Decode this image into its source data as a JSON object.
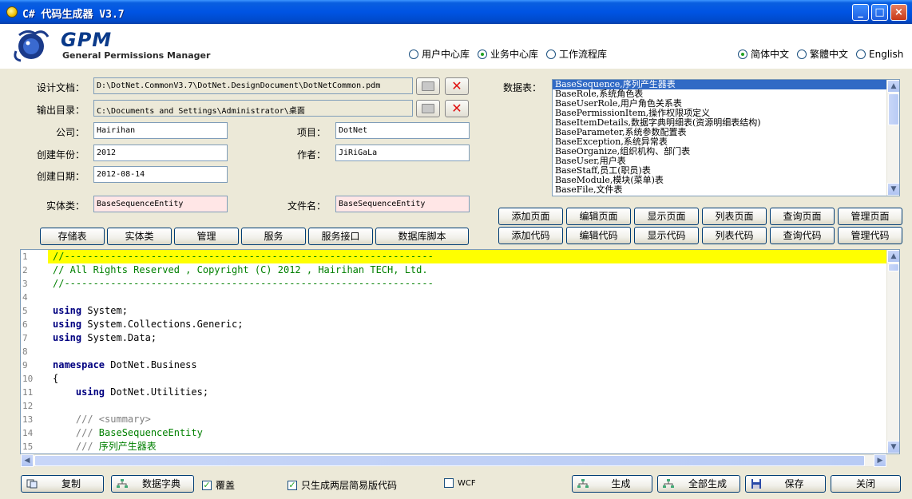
{
  "window": {
    "title": "C# 代码生成器 V3.7"
  },
  "titlebar": {
    "minimize": "_",
    "maximize": "□",
    "close": "×"
  },
  "header": {
    "logo_text": "GPM",
    "logo_sub": "General Permissions Manager",
    "db_options": [
      "用户中心库",
      "业务中心库",
      "工作流程库"
    ],
    "db_selected": 1,
    "lang_options": [
      "简体中文",
      "繁體中文",
      "English"
    ],
    "lang_selected": 0
  },
  "form": {
    "design_doc_label": "设计文档：",
    "design_doc_value": "D:\\DotNet.CommonV3.7\\DotNet.DesignDocument\\DotNetCommon.pdm",
    "output_dir_label": "输出目录：",
    "output_dir_value": "C:\\Documents and Settings\\Administrator\\桌面",
    "company_label": "公司：",
    "company_value": "Hairihan",
    "project_label": "项目：",
    "project_value": "DotNet",
    "year_label": "创建年份：",
    "year_value": "2012",
    "author_label": "作者：",
    "author_value": "JiRiGaLa",
    "date_label": "创建日期：",
    "date_value": "2012-08-14",
    "entity_label": "实体类：",
    "entity_value": "BaseSequenceEntity",
    "filename_label": "文件名：",
    "filename_value": "BaseSequenceEntity"
  },
  "left_buttons": [
    "存储表",
    "实体类",
    "管理",
    "服务",
    "服务接口",
    "数据库脚本"
  ],
  "tables": {
    "label": "数据表：",
    "items": [
      "BaseSequence,序列产生器表",
      "BaseRole,系统角色表",
      "BaseUserRole,用户角色关系表",
      "BasePermissionItem,操作权限项定义",
      "BaseItemDetails,数据字典明细表(资源明细表结构)",
      "BaseParameter,系统参数配置表",
      "BaseException,系统异常表",
      "BaseOrganize,组织机构、部门表",
      "BaseUser,用户表",
      "BaseStaff,员工(职员)表",
      "BaseModule,模块(菜单)表",
      "BaseFile,文件表"
    ],
    "selected": 0
  },
  "page_buttons": [
    "添加页面",
    "编辑页面",
    "显示页面",
    "列表页面",
    "查询页面",
    "管理页面"
  ],
  "code_buttons": [
    "添加代码",
    "编辑代码",
    "显示代码",
    "列表代码",
    "查询代码",
    "管理代码"
  ],
  "editor": {
    "line_numbers": [
      "1",
      "2",
      "3",
      "4",
      "5",
      "6",
      "7",
      "8",
      "9",
      "10",
      "11",
      "12",
      "13",
      "14",
      "15"
    ],
    "lines": [
      {
        "segs": [
          {
            "t": "//----------------------------------------------------------------",
            "c": "c-com"
          }
        ],
        "hl": true
      },
      {
        "segs": [
          {
            "t": "// All Rights Reserved , Copyright (C) 2012 , Hairihan TECH, Ltd.",
            "c": "c-com"
          }
        ]
      },
      {
        "segs": [
          {
            "t": "//----------------------------------------------------------------",
            "c": "c-com"
          }
        ]
      },
      {
        "segs": []
      },
      {
        "segs": [
          {
            "t": "using",
            "c": "c-kw"
          },
          {
            "t": " System;",
            "c": ""
          }
        ]
      },
      {
        "segs": [
          {
            "t": "using",
            "c": "c-kw"
          },
          {
            "t": " System.Collections.Generic;",
            "c": ""
          }
        ]
      },
      {
        "segs": [
          {
            "t": "using",
            "c": "c-kw"
          },
          {
            "t": " System.Data;",
            "c": ""
          }
        ]
      },
      {
        "segs": []
      },
      {
        "segs": [
          {
            "t": "namespace",
            "c": "c-kw"
          },
          {
            "t": " DotNet.Business",
            "c": ""
          }
        ]
      },
      {
        "segs": [
          {
            "t": "{",
            "c": ""
          }
        ]
      },
      {
        "segs": [
          {
            "t": "    ",
            "c": ""
          },
          {
            "t": "using",
            "c": "c-kw"
          },
          {
            "t": " DotNet.Utilities;",
            "c": ""
          }
        ]
      },
      {
        "segs": []
      },
      {
        "segs": [
          {
            "t": "    /// ",
            "c": "c-doc"
          },
          {
            "t": "<summary>",
            "c": "c-doc"
          }
        ]
      },
      {
        "segs": [
          {
            "t": "    /// ",
            "c": "c-doc"
          },
          {
            "t": "BaseSequenceEntity",
            "c": "c-docg"
          }
        ]
      },
      {
        "segs": [
          {
            "t": "    /// ",
            "c": "c-doc"
          },
          {
            "t": "序列产生器表",
            "c": "c-docg"
          }
        ]
      }
    ]
  },
  "bottom": {
    "copy_label": "复制",
    "dict_label": "数据字典",
    "overwrite_label": "覆盖",
    "overwrite_checked": true,
    "twolayer_label": "只生成两层简易版代码",
    "twolayer_checked": true,
    "wcf_label": "WCF",
    "wcf_checked": false,
    "generate_label": "生成",
    "generate_all_label": "全部生成",
    "save_label": "保存",
    "close_label": "关闭"
  },
  "colors": {
    "accent": "#0054e3",
    "selection": "#316ac5",
    "highlight": "#ffff00",
    "comment": "#008000"
  }
}
